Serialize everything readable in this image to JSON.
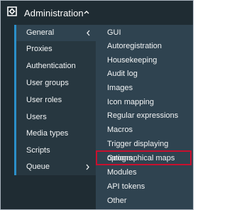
{
  "header": {
    "title": "Administration",
    "icon": "gear-icon"
  },
  "left_menu": {
    "items": [
      {
        "label": "General",
        "active": true,
        "chevron": "chevron-left-icon"
      },
      {
        "label": "Proxies"
      },
      {
        "label": "Authentication"
      },
      {
        "label": "User groups"
      },
      {
        "label": "User roles"
      },
      {
        "label": "Users"
      },
      {
        "label": "Media types"
      },
      {
        "label": "Scripts"
      },
      {
        "label": "Queue",
        "chevron": "chevron-right-icon"
      }
    ]
  },
  "submenu": {
    "items": [
      {
        "label": "GUI"
      },
      {
        "label": "Autoregistration"
      },
      {
        "label": "Housekeeping"
      },
      {
        "label": "Audit log"
      },
      {
        "label": "Images"
      },
      {
        "label": "Icon mapping"
      },
      {
        "label": "Regular expressions"
      },
      {
        "label": "Macros"
      },
      {
        "label": "Trigger displaying options"
      },
      {
        "label": "Geographical maps",
        "highlighted": true
      },
      {
        "label": "Modules"
      },
      {
        "label": "API tokens"
      },
      {
        "label": "Other"
      }
    ]
  },
  "colors": {
    "background": "#1f2c33",
    "left_menu": "#273740",
    "submenu": "#2f4350",
    "accent": "#2b8fc9",
    "highlight_border": "#c8102e",
    "text": "#f2f4f5"
  }
}
